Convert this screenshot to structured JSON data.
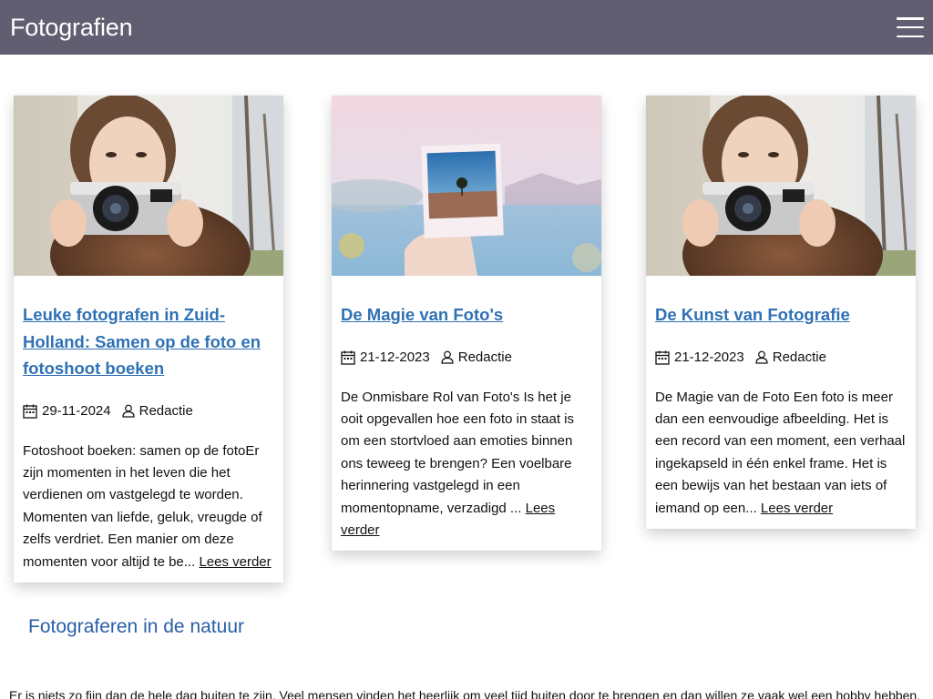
{
  "header": {
    "site_title": "Fotografien",
    "menu_icon": "hamburger-menu-icon"
  },
  "posts": [
    {
      "image_subject": "woman-with-camera",
      "title": "Leuke fotografen in Zuid-Holland: Samen op de foto en fotoshoot boeken",
      "date": "29-11-2024",
      "author": "Redactie",
      "excerpt": "Fotoshoot boeken: samen op de fotoEr zijn momenten in het leven die het verdienen om vastgelegd te worden. Momenten van liefde, geluk, vreugde of zelfs verdriet. Een manier om deze momenten voor altijd te be... ",
      "read_more": "Lees verder"
    },
    {
      "image_subject": "hand-holding-polaroid",
      "title": "De Magie van Foto's",
      "date": "21-12-2023",
      "author": "Redactie",
      "excerpt": "De Onmisbare Rol van Foto's Is het je ooit opgevallen hoe een foto in staat is om een stortvloed aan emoties binnen ons teweeg te brengen? Een voelbare herinnering vastgelegd in een momentopname, verzadigd ... ",
      "read_more": "Lees verder"
    },
    {
      "image_subject": "woman-with-camera",
      "title": "De Kunst van Fotografie",
      "date": "21-12-2023",
      "author": "Redactie",
      "excerpt": "De Magie van de Foto Een foto is meer dan een eenvoudige afbeelding. Het is een record van een moment, een verhaal ingekapseld in één enkel frame. Het is een bewijs van het bestaan van iets of iemand op een... ",
      "read_more": "Lees verder"
    }
  ],
  "section": {
    "heading": "Fotograferen in de natuur",
    "intro": "Er is niets zo fijn dan de hele dag buiten te zijn. Veel mensen vinden het heerlijk om veel tijd buiten door te brengen en dan willen ze vaak wel een hobby hebben. Een"
  },
  "colors": {
    "header_bg": "#625e72",
    "link_blue": "#2f71b5",
    "heading_blue": "#2a5fa6"
  }
}
